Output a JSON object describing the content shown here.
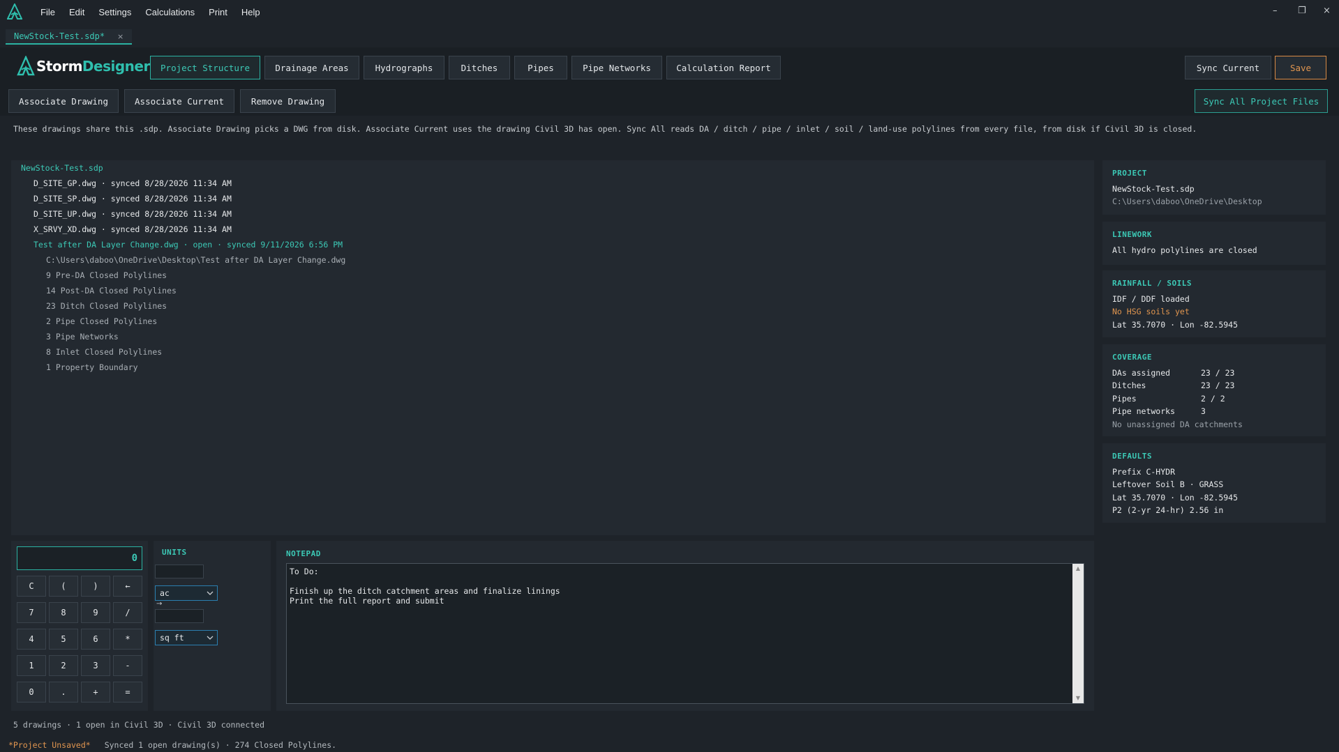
{
  "menu": [
    "File",
    "Edit",
    "Settings",
    "Calculations",
    "Print",
    "Help"
  ],
  "window_controls": {
    "minimize": "–",
    "restore": "❐",
    "close": "×"
  },
  "doc_tab": {
    "label": "NewStock-Test.sdp*",
    "close": "×"
  },
  "brand": {
    "part1": "Storm",
    "part2": "Designer"
  },
  "tabs": [
    "Project Structure",
    "Drainage Areas",
    "Hydrographs",
    "Ditches",
    "Pipes",
    "Pipe Networks",
    "Calculation Report"
  ],
  "toolbar_right": {
    "sync_current": "Sync Current",
    "save": "Save",
    "sync_all": "Sync All Project Files"
  },
  "actions": [
    "Associate Drawing",
    "Associate Current",
    "Remove Drawing"
  ],
  "info_line": "These drawings share this .sdp. Associate Drawing picks a DWG from disk. Associate Current uses the drawing Civil 3D has open. Sync All reads DA / ditch / pipe / inlet / soil / land-use polylines from every file, from disk if Civil 3D is closed.",
  "tree": {
    "root": "NewStock-Test.sdp",
    "files": [
      "D_SITE_GP.dwg  ·  synced 8/28/2026 11:34 AM",
      "D_SITE_SP.dwg  ·  synced 8/28/2026 11:34 AM",
      "D_SITE_UP.dwg  ·  synced 8/28/2026 11:34 AM",
      "X_SRVY_XD.dwg  ·  synced 8/28/2026 11:34 AM"
    ],
    "open_file": "Test after DA Layer Change.dwg  ·  open  ·  synced 9/11/2026 6:56 PM",
    "open_details": [
      "C:\\Users\\daboo\\OneDrive\\Desktop\\Test after DA Layer Change.dwg",
      "9 Pre-DA Closed Polylines",
      "14 Post-DA Closed Polylines",
      "23 Ditch Closed Polylines",
      "2 Pipe Closed Polylines",
      "3 Pipe Networks",
      "8 Inlet Closed Polylines",
      "1 Property Boundary"
    ]
  },
  "cards": {
    "project": {
      "title": "PROJECT",
      "name": "NewStock-Test.sdp",
      "path": "C:\\Users\\daboo\\OneDrive\\Desktop"
    },
    "linework": {
      "title": "LINEWORK",
      "status": "All hydro polylines are closed"
    },
    "rainfall": {
      "title": "RAINFALL / SOILS",
      "idf": "IDF / DDF loaded",
      "soils": "No HSG soils yet",
      "latlon": "Lat 35.7070  ·  Lon -82.5945"
    },
    "coverage": {
      "title": "COVERAGE",
      "rows": [
        {
          "k": "DAs assigned",
          "v": "23 / 23"
        },
        {
          "k": "Ditches",
          "v": "23 / 23"
        },
        {
          "k": "Pipes",
          "v": "2 / 2"
        },
        {
          "k": "Pipe networks",
          "v": "3"
        }
      ],
      "note": "No unassigned DA catchments"
    },
    "defaults": {
      "title": "DEFAULTS",
      "lines": [
        "Prefix  C-HYDR",
        "Leftover  Soil B  ·  GRASS",
        "Lat 35.7070  ·  Lon -82.5945",
        "P2 (2-yr 24-hr)  2.56 in"
      ]
    }
  },
  "calculator": {
    "display": "0",
    "keys": [
      "C",
      "(",
      ")",
      "←",
      "7",
      "8",
      "9",
      "/",
      "4",
      "5",
      "6",
      "*",
      "1",
      "2",
      "3",
      "-",
      "0",
      ".",
      "+",
      "="
    ]
  },
  "units": {
    "title": "UNITS",
    "from_unit": "ac",
    "arrow": "→",
    "to_unit": "sq ft"
  },
  "notepad": {
    "title": "NOTEPAD",
    "text": "To Do:\n\nFinish up the ditch catchment areas and finalize linings\nPrint the full report and submit"
  },
  "status": {
    "line1": "5 drawings  ·  1 open in Civil 3D  ·  Civil 3D connected",
    "unsaved": "*Project Unsaved*",
    "line2": "Synced 1 open drawing(s)  ·  274 Closed Polylines."
  },
  "colors": {
    "accent": "#3cc9b6",
    "warning": "#e0954f",
    "background": "#1e2329",
    "panel": "#232930"
  }
}
